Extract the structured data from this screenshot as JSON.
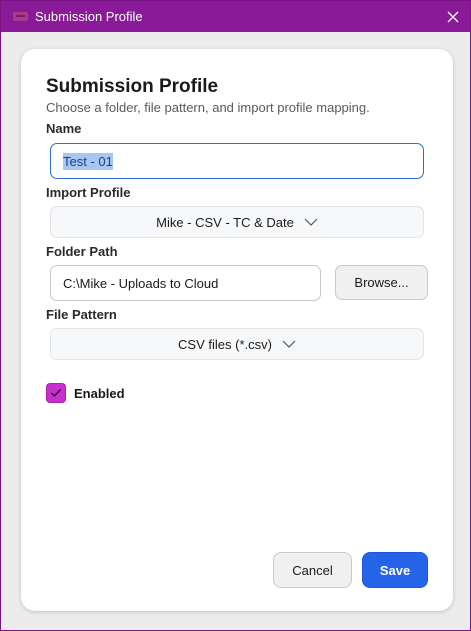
{
  "window": {
    "title": "Submission Profile",
    "app_icon": "app-icon",
    "close_icon": "close-icon"
  },
  "dialog": {
    "heading": "Submission Profile",
    "subtitle": "Choose a folder, file pattern, and import profile mapping."
  },
  "fields": {
    "name": {
      "label": "Name",
      "value": "Test - 01",
      "text_selected": true
    },
    "import_profile": {
      "label": "Import Profile",
      "selected": "Mike - CSV - TC & Date",
      "icon": "chevron-down-icon"
    },
    "folder_path": {
      "label": "Folder Path",
      "value": "C:\\Mike - Uploads to Cloud",
      "browse_label": "Browse..."
    },
    "file_pattern": {
      "label": "File Pattern",
      "selected": "CSV files (*.csv)",
      "icon": "chevron-down-icon"
    },
    "enabled": {
      "label": "Enabled",
      "checked": true,
      "icon": "checkmark-icon"
    }
  },
  "actions": {
    "cancel_label": "Cancel",
    "save_label": "Save"
  },
  "colors": {
    "titlebar": "#8a1b98",
    "accent_checkbox": "#c72fcf",
    "primary_button": "#2563e8",
    "focus_border": "#2d6fd6",
    "selection": "#a8c7f0"
  }
}
